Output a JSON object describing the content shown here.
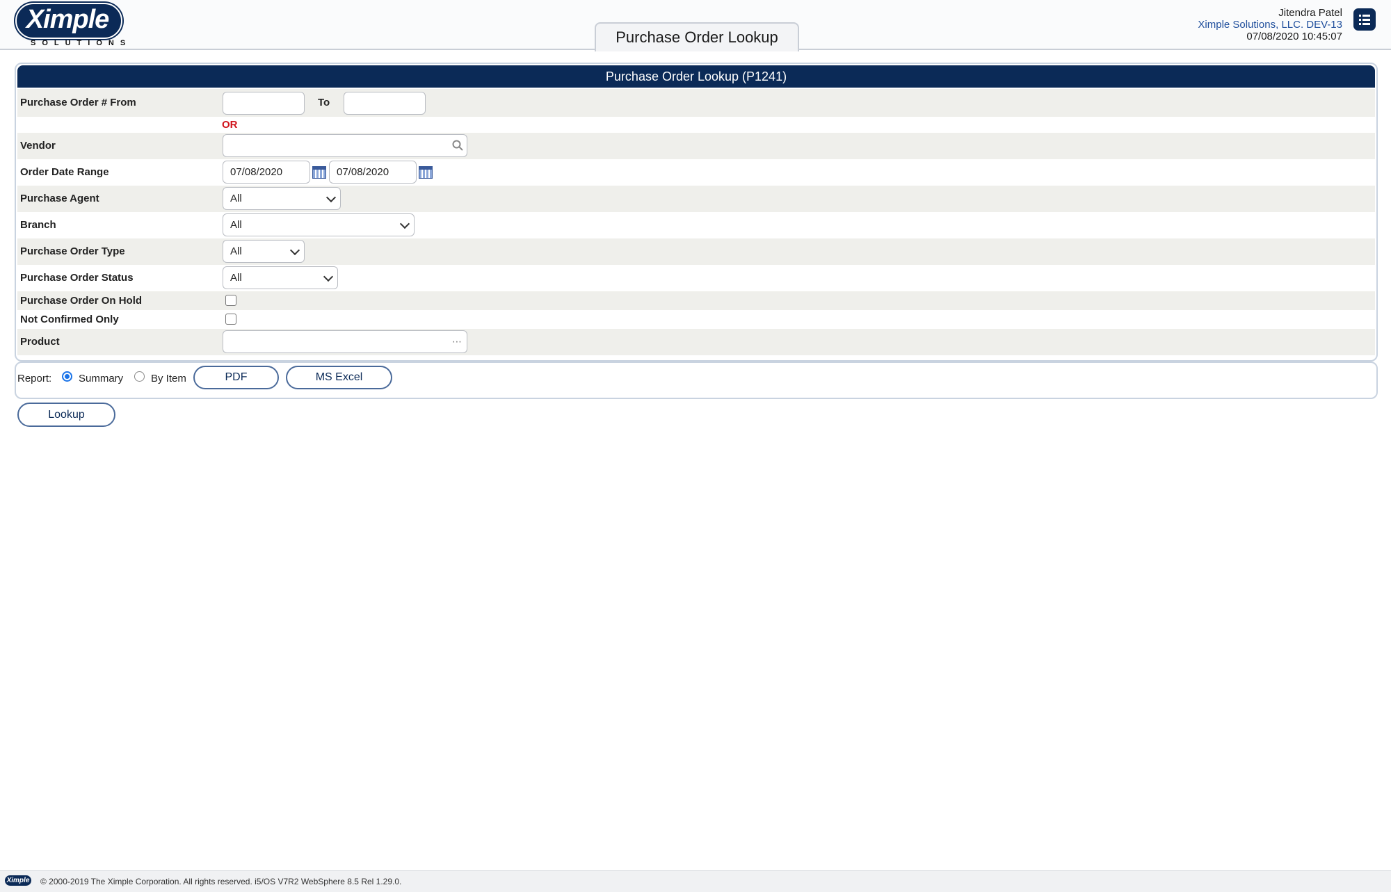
{
  "header": {
    "logo_word": "Ximple",
    "logo_sub": "SOLUTIONS",
    "page_tab": "Purchase Order Lookup",
    "user_name": "Jitendra Patel",
    "company": "Ximple Solutions, LLC. DEV-13",
    "datetime": "07/08/2020 10:45:07",
    "menu_icon": "list-icon"
  },
  "form": {
    "title": "Purchase Order Lookup (P1241)",
    "po_from_label": "Purchase Order #  From",
    "po_from_value": "",
    "po_to_label": "To",
    "po_to_value": "",
    "or_text": "OR",
    "vendor_label": "Vendor",
    "vendor_value": "",
    "vendor_icon": "search-icon",
    "order_date_label": "Order Date Range",
    "order_date_from": "07/08/2020",
    "order_date_to": "07/08/2020",
    "calendar_icon": "calendar-icon",
    "purchase_agent_label": "Purchase Agent",
    "purchase_agent_value": "All",
    "branch_label": "Branch",
    "branch_value": "All",
    "po_type_label": "Purchase Order Type",
    "po_type_value": "All",
    "po_status_label": "Purchase Order Status",
    "po_status_value": "All",
    "on_hold_label": "Purchase Order On Hold",
    "on_hold_checked": false,
    "not_confirmed_label": "Not Confirmed Only",
    "not_confirmed_checked": false,
    "product_label": "Product",
    "product_value": "",
    "product_icon": "ellipsis-icon"
  },
  "report": {
    "label": "Report:",
    "summary_label": "Summary",
    "summary_selected": true,
    "by_item_label": "By Item",
    "by_item_selected": false,
    "pdf_label": "PDF",
    "excel_label": "MS Excel"
  },
  "actions": {
    "lookup_label": "Lookup"
  },
  "footer": {
    "logo_word": "Ximple",
    "copyright": "© 2000-2019 The Ximple Corporation. All rights reserved. i5/OS V7R2 WebSphere 8.5 Rel 1.29.0."
  },
  "colors": {
    "brand_navy": "#0b2a57",
    "accent_blue": "#1f4e9c",
    "or_red": "#d0131b",
    "row_shade": "#efefeb"
  }
}
